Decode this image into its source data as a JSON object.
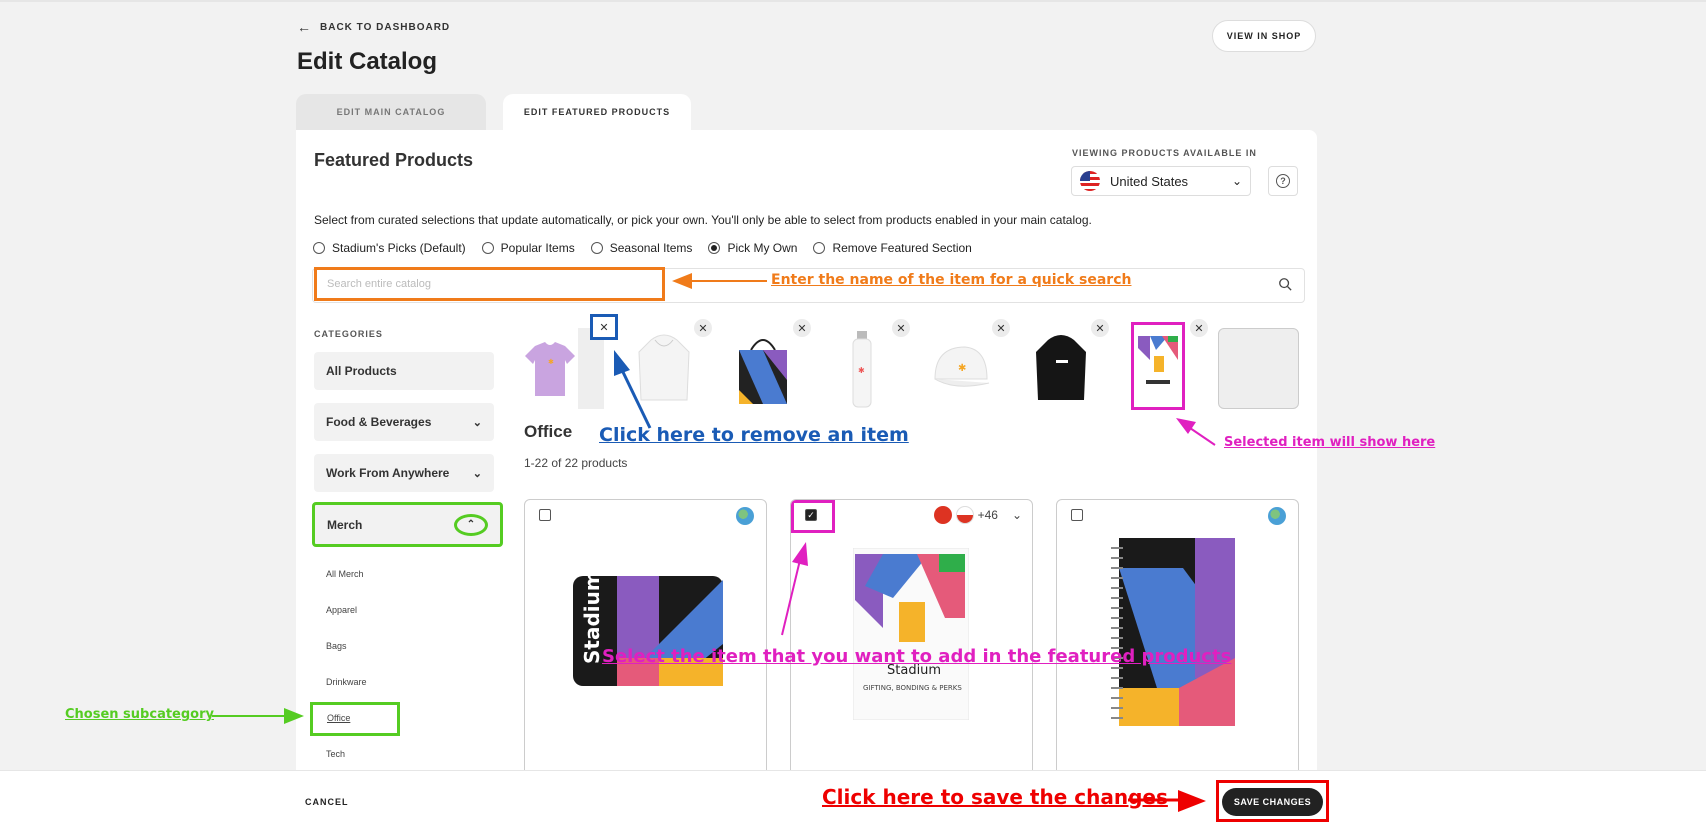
{
  "header": {
    "back_label": "BACK TO DASHBOARD",
    "page_title": "Edit Catalog",
    "view_in_shop": "VIEW IN SHOP"
  },
  "tabs": [
    {
      "label": "EDIT MAIN CATALOG",
      "active": false
    },
    {
      "label": "EDIT FEATURED PRODUCTS",
      "active": true
    }
  ],
  "featured": {
    "title": "Featured Products",
    "viewing_label": "VIEWING PRODUCTS AVAILABLE IN",
    "country": "United States",
    "description": "Select from curated selections that update automatically, or pick your own. You'll only be able to select from products enabled in your main catalog.",
    "options": [
      {
        "label": "Stadium's Picks (Default)",
        "checked": false
      },
      {
        "label": "Popular Items",
        "checked": false
      },
      {
        "label": "Seasonal Items",
        "checked": false
      },
      {
        "label": "Pick My Own",
        "checked": true
      },
      {
        "label": "Remove Featured Section",
        "checked": false
      }
    ],
    "search_placeholder": "Search entire catalog"
  },
  "categories": {
    "label": "CATEGORIES",
    "items": [
      "All Products",
      "Food & Beverages",
      "Work From Anywhere",
      "Merch"
    ],
    "sub_items": [
      "All Merch",
      "Apparel",
      "Bags",
      "Drinkware",
      "Office",
      "Tech"
    ],
    "selected_sub": "Office"
  },
  "selected_items": [
    "t-shirt",
    "hoodie-white",
    "tote-bag",
    "water-bottle",
    "cap",
    "hoodie-black",
    "notebook-cover"
  ],
  "listing": {
    "title": "Office",
    "count": "1-22 of 22 products",
    "cards": [
      {
        "product": "laptop-sleeve",
        "checked": false,
        "availability": "globe"
      },
      {
        "product": "notebook",
        "checked": true,
        "availability_more": "+46"
      },
      {
        "product": "spiral-notebook",
        "checked": false,
        "availability": "globe"
      }
    ]
  },
  "annotations": {
    "search": "Enter the name of the item for a quick search",
    "remove": "Click here to remove an item",
    "selected": "Selected item will show here",
    "select": "Select the item that you want to add in the featured products",
    "subcategory": "Chosen subcategory",
    "save": "Click here to save the changes"
  },
  "footer": {
    "cancel": "CANCEL",
    "save": "SAVE CHANGES"
  },
  "colors": {
    "annotation_orange": "#f07b1a",
    "annotation_blue": "#1a5bb5",
    "annotation_pink": "#e020c0",
    "annotation_green": "#55cc22",
    "annotation_red": "#ee0000"
  }
}
